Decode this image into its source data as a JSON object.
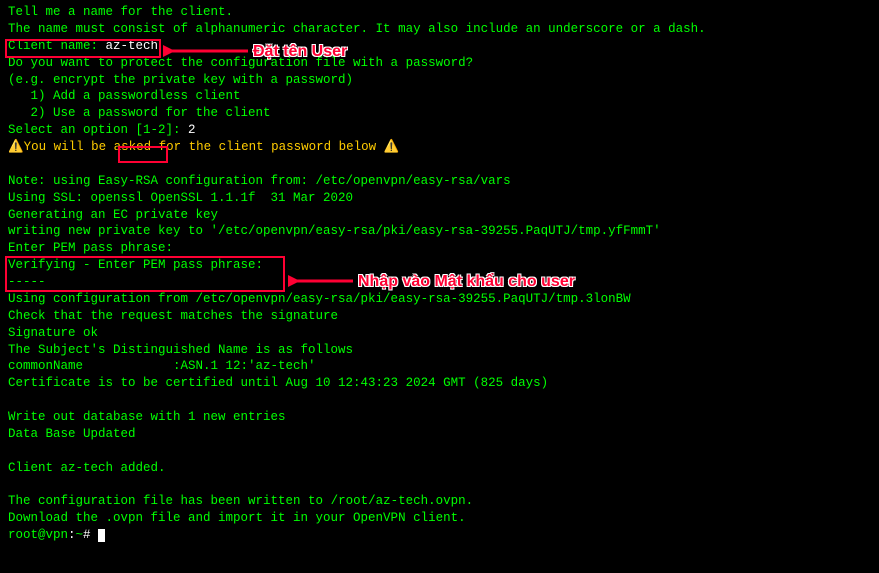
{
  "lines": {
    "l1": "Tell me a name for the client.",
    "l2": "The name must consist of alphanumeric character. It may also include an underscore or a dash.",
    "l3a": "Client name: ",
    "l3b": "az-tech",
    "l4": "",
    "l5": "Do you want to protect the configuration file with a password?",
    "l6": "(e.g. encrypt the private key with a password)",
    "l7": "   1) Add a passwordless client",
    "l8": "   2) Use a password for the client",
    "l9a": "Select an option ",
    "l9b": "[1-2]: ",
    "l9c": "2",
    "l10pre": "⚠️",
    "l10": "You will be asked for the client password below ",
    "l10post": "⚠️",
    "l11": "",
    "l12": "Note: using Easy-RSA configuration from: /etc/openvpn/easy-rsa/vars",
    "l13": "Using SSL: openssl OpenSSL 1.1.1f  31 Mar 2020",
    "l14": "Generating an EC private key",
    "l15": "writing new private key to '/etc/openvpn/easy-rsa/pki/easy-rsa-39255.PaqUTJ/tmp.yfFmmT'",
    "l16": "Enter PEM pass phrase:",
    "l17": "Verifying - Enter PEM pass phrase:",
    "l18": "-----",
    "l19": "Using configuration from /etc/openvpn/easy-rsa/pki/easy-rsa-39255.PaqUTJ/tmp.3lonBW",
    "l20": "Check that the request matches the signature",
    "l21": "Signature ok",
    "l22": "The Subject's Distinguished Name is as follows",
    "l23": "commonName            :ASN.1 12:'az-tech'",
    "l24": "Certificate is to be certified until Aug 10 12:43:23 2024 GMT (825 days)",
    "l25": "",
    "l26": "Write out database with 1 new entries",
    "l27": "Data Base Updated",
    "l28": "",
    "l29": "Client az-tech added.",
    "l30": "",
    "l31": "The configuration file has been written to ",
    "l31b": "/root/az-tech.ovpn",
    "l31c": ".",
    "l32": "Download the .ovpn file and import it in your OpenVPN client.",
    "l33a": "root@vpn",
    "l33b": ":",
    "l33c": "~",
    "l33d": "# "
  },
  "annotations": {
    "a1": "Đặt tên User",
    "a2": "Nhập vào Mật khẩu cho user"
  },
  "colors": {
    "terminal_fg": "#00ff00",
    "terminal_bg": "#000000",
    "highlight": "#ff0033",
    "warning": "#ffcc00"
  }
}
